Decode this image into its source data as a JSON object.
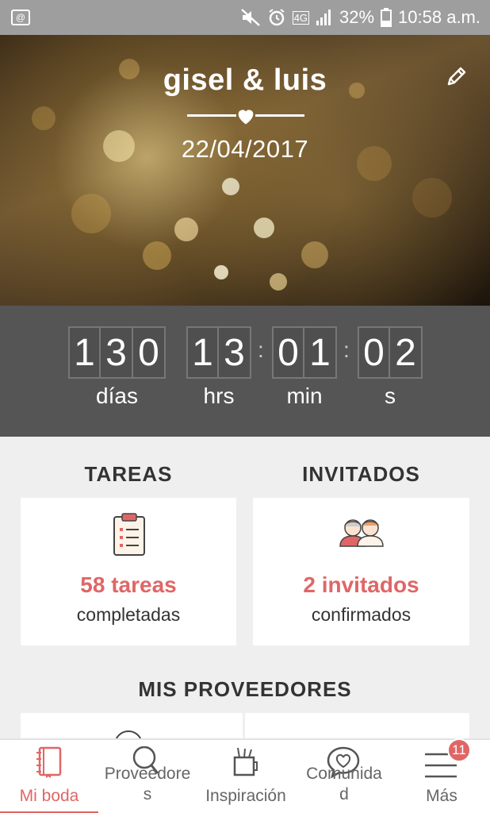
{
  "status_bar": {
    "battery": "32%",
    "time": "10:58 a.m.",
    "network": "4G",
    "icons": [
      "mute-icon",
      "alarm-icon",
      "signal-icon",
      "battery-icon"
    ]
  },
  "hero": {
    "title": "gisel & luis",
    "date": "22/04/2017"
  },
  "countdown": {
    "days": [
      "1",
      "3",
      "0"
    ],
    "hours": [
      "1",
      "3"
    ],
    "minutes": [
      "0",
      "1"
    ],
    "seconds": [
      "0",
      "2"
    ],
    "labels": {
      "days": "días",
      "hours": "hrs",
      "minutes": "min",
      "seconds": "s"
    },
    "separator": ":"
  },
  "tasks": {
    "title": "TAREAS",
    "count": "58 tareas",
    "sub": "completadas"
  },
  "guests": {
    "title": "INVITADOS",
    "count": "2 invitados",
    "sub": "confirmados"
  },
  "vendors": {
    "title": "MIS PROVEEDORES"
  },
  "nav": {
    "items": [
      {
        "label": "Mi boda",
        "icon": "notebook-icon"
      },
      {
        "label_line1": "Proveedore",
        "label_line2": "s",
        "icon": "search-icon"
      },
      {
        "label": "Inspiración",
        "icon": "pencil-cup-icon"
      },
      {
        "label_line1": "Comunida",
        "label_line2": "d",
        "icon": "heart-bubble-icon"
      },
      {
        "label": "Más",
        "icon": "menu-icon",
        "badge": "11"
      }
    ]
  },
  "colors": {
    "accent": "#e06666",
    "countdown_bg": "#555556",
    "page_bg": "#efefef"
  }
}
